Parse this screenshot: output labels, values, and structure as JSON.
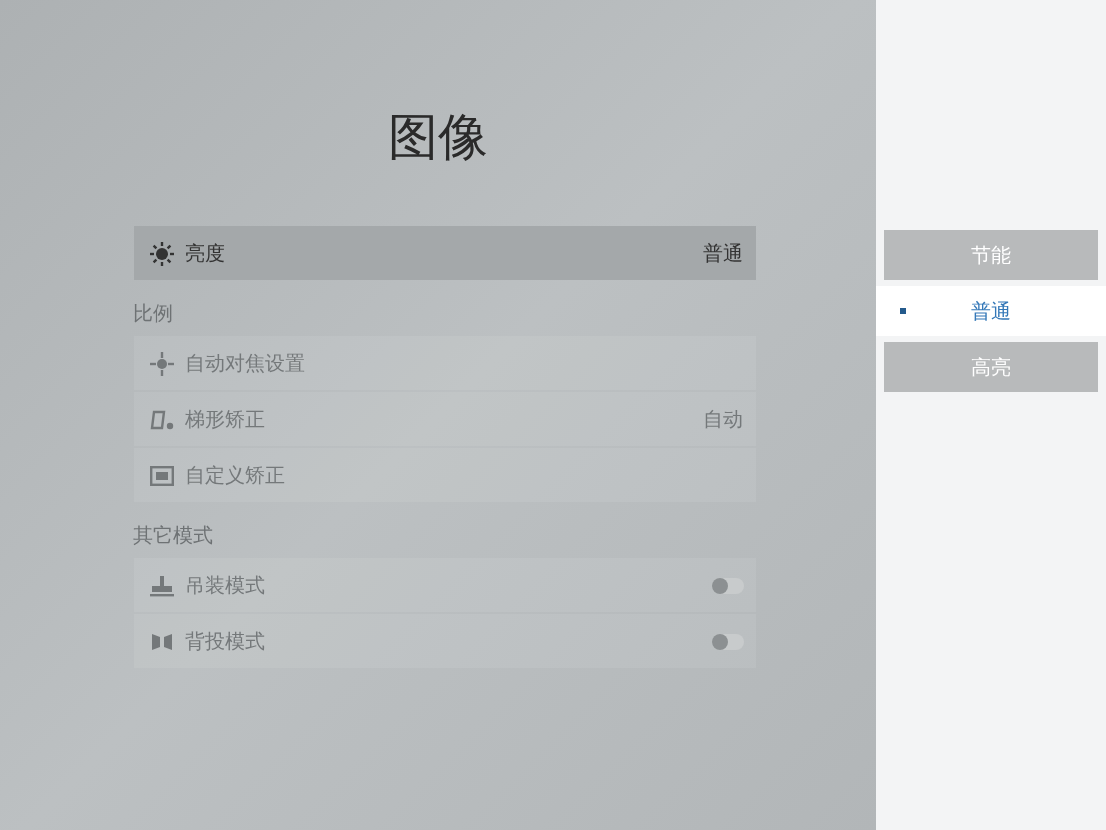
{
  "title": "图像",
  "groups": [
    {
      "rows": [
        {
          "kind": "value",
          "label": "亮度",
          "value": "普通",
          "selected": true
        }
      ]
    },
    {
      "heading": "比例",
      "rows": [
        {
          "kind": "link",
          "label": "自动对焦设置",
          "selected": false
        },
        {
          "kind": "value",
          "label": "梯形矫正",
          "value": "自动",
          "selected": false
        },
        {
          "kind": "link",
          "label": "自定义矫正",
          "selected": false
        }
      ]
    },
    {
      "heading": "其它模式",
      "rows": [
        {
          "kind": "toggle",
          "label": "吊装模式",
          "on": false,
          "selected": false
        },
        {
          "kind": "toggle",
          "label": "背投模式",
          "on": false,
          "selected": false
        }
      ]
    }
  ],
  "options": [
    {
      "label": "节能",
      "selected": false
    },
    {
      "label": "普通",
      "selected": true
    },
    {
      "label": "高亮",
      "selected": false
    }
  ]
}
